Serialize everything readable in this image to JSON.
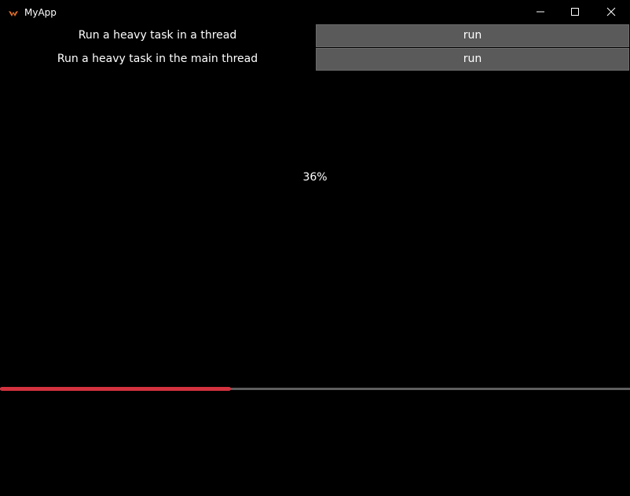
{
  "window": {
    "title": "MyApp",
    "icon": "app-logo-icon",
    "controls": {
      "minimize_icon": "minimize-icon",
      "maximize_icon": "maximize-icon",
      "close_icon": "close-icon"
    }
  },
  "rows": [
    {
      "label": "Run a heavy task in a thread",
      "button": "run"
    },
    {
      "label": "Run a heavy task in the main thread",
      "button": "run"
    }
  ],
  "progress": {
    "text": "36%",
    "value": 0.366
  },
  "colors": {
    "background": "#000000",
    "button": "#5a5a5a",
    "progress_fill": "#d3323f",
    "progress_track": "#5e5e5e"
  }
}
